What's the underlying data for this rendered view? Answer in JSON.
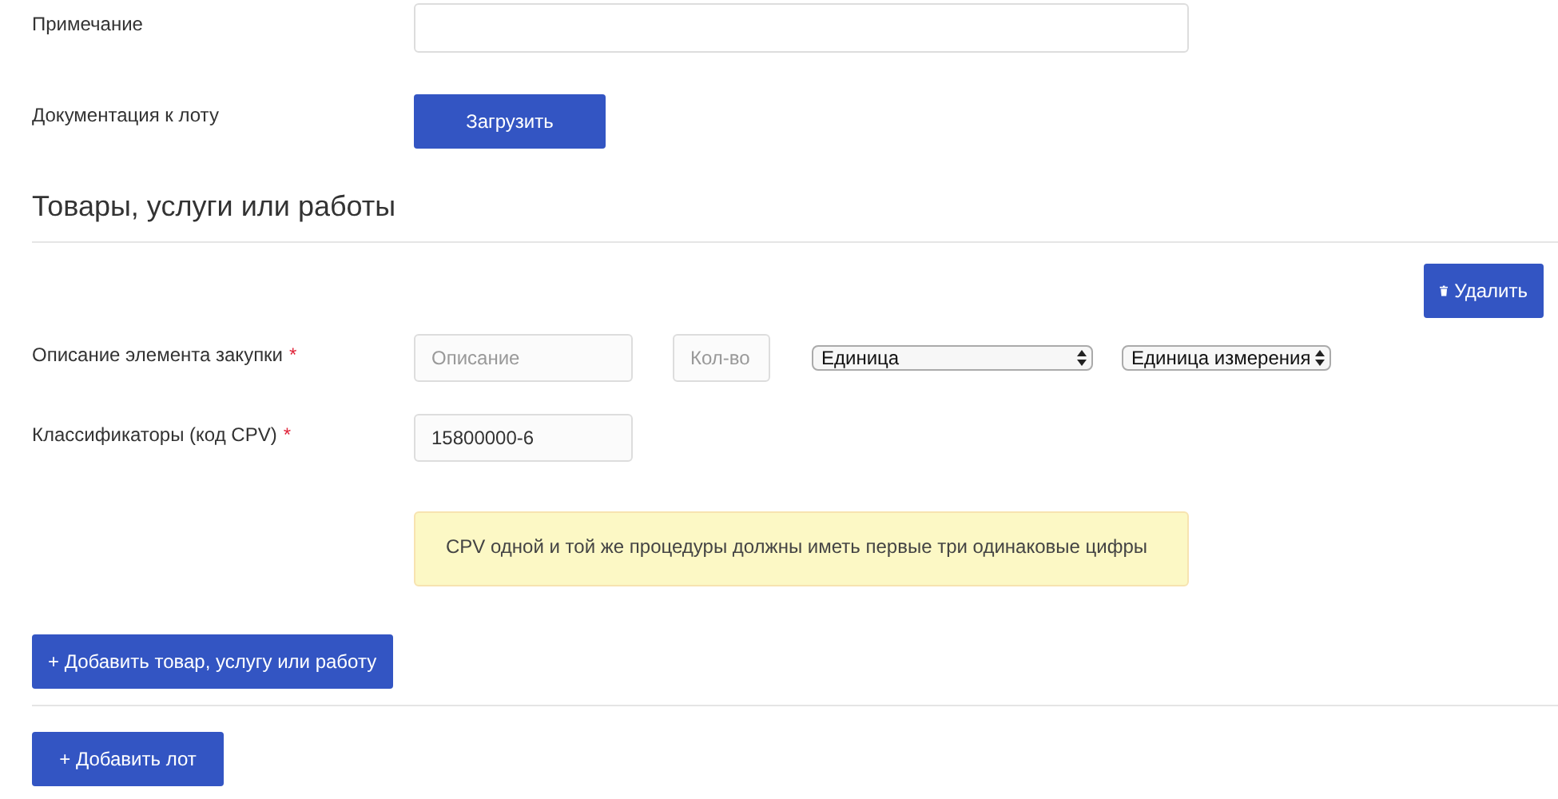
{
  "fields": [
    {
      "kind": "text",
      "label": "Примечание"
    },
    {
      "kind": "upload",
      "label": "Документация к лоту",
      "button": "Загрузить"
    }
  ],
  "section": {
    "title": "Товары, услуги или работы"
  },
  "item": {
    "delete_button": "Удалить",
    "description": {
      "label": "Описание элемента закупки",
      "required_mark": "*",
      "placeholder": "Описание"
    },
    "quantity": {
      "placeholder": "Кол-во"
    },
    "unit_selects": [
      "Единица",
      "Единица измерения"
    ],
    "classifier": {
      "label": "Классификаторы (код CPV)",
      "required_mark": "*",
      "value": "15800000-6"
    },
    "notice": "CPV одной и той же процедуры должны иметь первые три одинаковые цифры"
  },
  "add_item_button": "+ Добавить товар, услугу или работу",
  "add_lot_button": "+ Добавить лот"
}
